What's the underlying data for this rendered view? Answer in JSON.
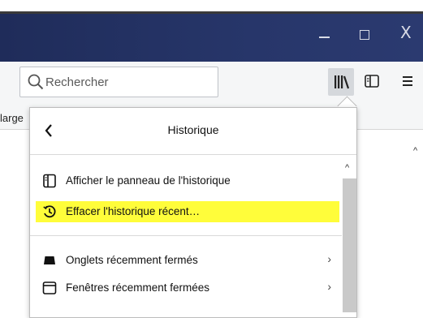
{
  "window": {
    "minimize_icon": "minimize-icon",
    "maximize_icon": "maximize-icon",
    "close_glyph": "X"
  },
  "toolbar": {
    "search_placeholder": "Rechercher",
    "library_icon": "library-icon",
    "sidebar_icon": "sidebar-icon",
    "menu_icon": "hamburger-menu-icon"
  },
  "bookmarks_bar": {
    "truncated_text": "large"
  },
  "history_panel": {
    "title": "Historique",
    "items": [
      {
        "label": "Afficher le panneau de l'historique",
        "icon": "history-sidebar-icon",
        "highlighted": false
      },
      {
        "label": "Effacer l'historique récent…",
        "icon": "clear-history-icon",
        "highlighted": true
      },
      {
        "label": "Onglets récemment fermés",
        "icon": "tab-icon",
        "submenu": true
      },
      {
        "label": "Fenêtres récemment fermées",
        "icon": "window-icon",
        "submenu": true
      }
    ],
    "highlight_color": "#fffd3a"
  }
}
